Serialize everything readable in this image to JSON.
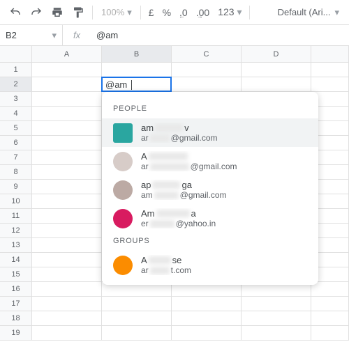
{
  "toolbar": {
    "zoom": "100%",
    "currency": "£",
    "percent": "%",
    "dec_dec": ".0",
    "inc_dec": ".00",
    "format": "123",
    "font": "Default (Ari..."
  },
  "nameBox": "B2",
  "fx": "fx",
  "formula": "@am",
  "columns": [
    "A",
    "B",
    "C",
    "D"
  ],
  "rowCount": 19,
  "activeCell": {
    "value": "@am",
    "col": "B",
    "row": 2
  },
  "autocomplete": {
    "sections": [
      {
        "title": "PEOPLE",
        "items": [
          {
            "name_prefix": "am",
            "name_hidden": "█████",
            "name_suffix": "v",
            "email_prefix": "ar",
            "email_hidden": "████",
            "email_suffix": "@gmail.com",
            "avatar": "#2aa6a0",
            "shape": "sq",
            "selected": true
          },
          {
            "name_prefix": "A",
            "name_hidden": "███████",
            "name_suffix": "",
            "email_prefix": "ar",
            "email_hidden": "████████",
            "email_suffix": "@gmail.com",
            "avatar": "#d7ccc8",
            "shape": "round",
            "selected": false
          },
          {
            "name_prefix": "ap",
            "name_hidden": "█████",
            "name_suffix": "ga",
            "email_prefix": "am",
            "email_hidden": "█████",
            "email_suffix": "@gmail.com",
            "avatar": "#bcaaa4",
            "shape": "round",
            "selected": false
          },
          {
            "name_prefix": "Am",
            "name_hidden": "██████",
            "name_suffix": "a",
            "email_prefix": "er",
            "email_hidden": "█████",
            "email_suffix": "@yahoo.in",
            "avatar": "#d81b60",
            "shape": "round",
            "selected": false
          }
        ]
      },
      {
        "title": "GROUPS",
        "items": [
          {
            "name_prefix": "A",
            "name_hidden": "████",
            "name_suffix": "se",
            "email_prefix": "ar",
            "email_hidden": "████",
            "email_suffix": "t.com",
            "avatar": "#fb8c00",
            "shape": "round",
            "selected": false
          }
        ]
      }
    ]
  }
}
